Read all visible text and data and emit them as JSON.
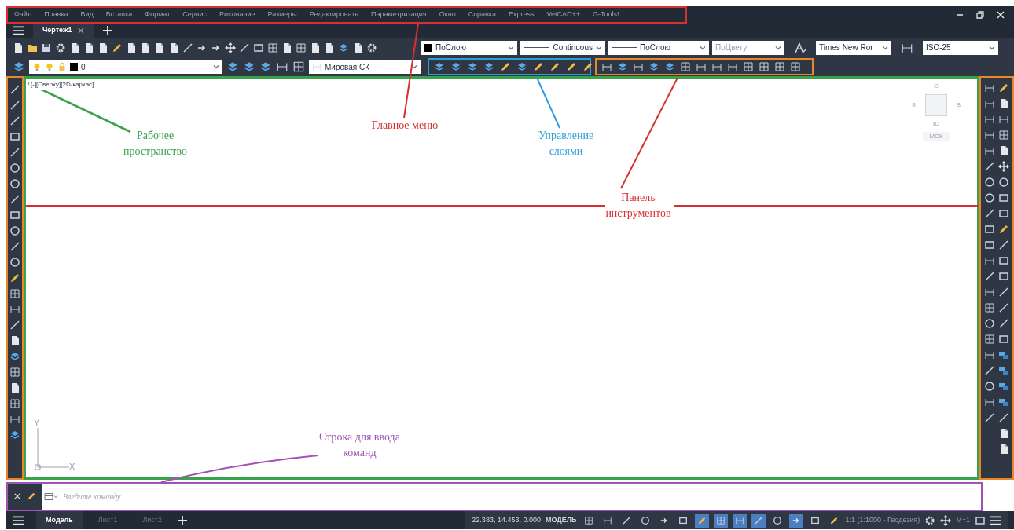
{
  "menu_bar": {
    "items": [
      "Файл",
      "Правка",
      "Вид",
      "Вставка",
      "Формат",
      "Сервис",
      "Рисование",
      "Размеры",
      "Редактировать",
      "Параметризация",
      "Окно",
      "Справка",
      "Express",
      "VetCAD++",
      "G-Tools!"
    ]
  },
  "document_tabs": [
    {
      "label": "Чертеж1",
      "selected": true
    }
  ],
  "properties_toolbar": {
    "color_style": "ПоСлою",
    "linetype": "Continuous",
    "lineweight": "ПоСлою",
    "plot_style": {
      "value": "ПоЦвету",
      "disabled": true
    },
    "text_style": "Times New Ror",
    "dim_style": "ISO-25"
  },
  "layers_toolbar": {
    "layer": "0",
    "ucs": "Мировая СК"
  },
  "viewport": {
    "label": "[-][Сверху][2D-каркас]",
    "viewcube": {
      "north": "С",
      "west": "З",
      "east": "В",
      "south": "Ю",
      "ucs_button": "МСК"
    },
    "ucs_axes": {
      "y": "Y",
      "x": "X"
    }
  },
  "command_line": {
    "placeholder": "Введите команду"
  },
  "layout_tabs": [
    {
      "label": "Модель",
      "selected": true
    },
    {
      "label": "Лист1",
      "selected": false
    },
    {
      "label": "Лист2",
      "selected": false
    }
  ],
  "status_bar": {
    "coordinates": "22.383, 14.453, 0.000",
    "space": "МОДЕЛЬ",
    "scale": "1:1 (1:1000 - Геодезия)",
    "annotation_scale": "M=1",
    "toggles": [
      {
        "on": false
      },
      {
        "on": false
      },
      {
        "on": false
      },
      {
        "on": false
      },
      {
        "on": false
      },
      {
        "on": false
      },
      {
        "on": true
      },
      {
        "on": true
      },
      {
        "on": true
      },
      {
        "on": true
      },
      {
        "on": false
      },
      {
        "on": true
      },
      {
        "on": false
      },
      {
        "on": false
      }
    ]
  },
  "annotations": [
    {
      "text": "Главное меню",
      "color": "#d83030"
    },
    {
      "text": "Рабочее пространство",
      "color": "#3aa24a"
    },
    {
      "text": "Управление слоями",
      "color": "#2a9fd6"
    },
    {
      "text": "Панель инструментов",
      "color": "#d83030"
    },
    {
      "text": "Строка для ввода команд",
      "color": "#a052b8"
    }
  ]
}
